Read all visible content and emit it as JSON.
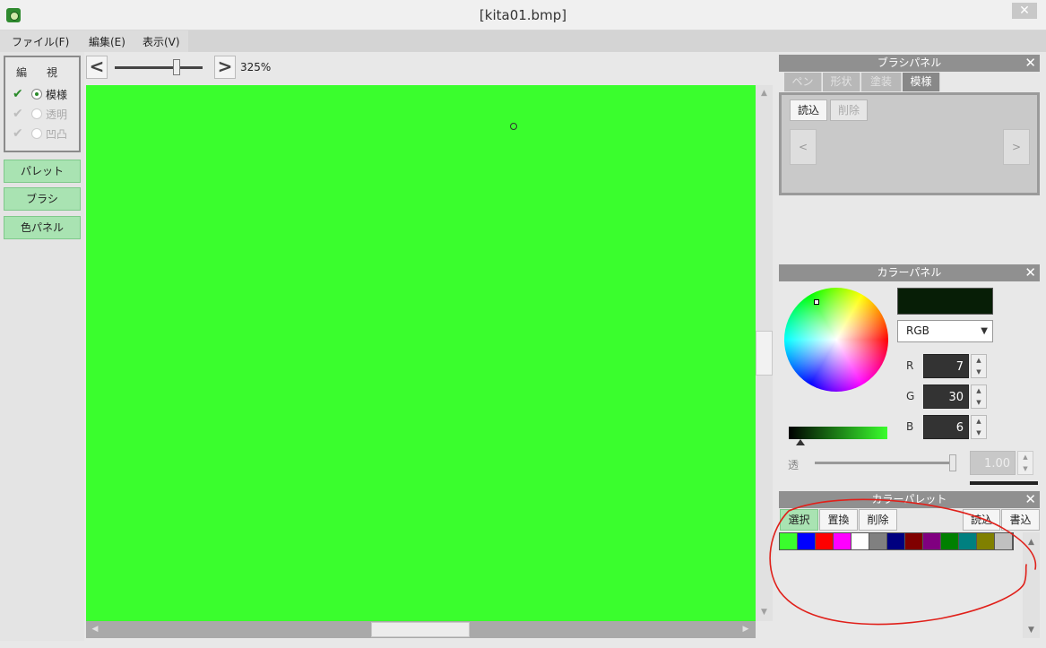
{
  "window": {
    "title": "[kita01.bmp]",
    "close_glyph": "✕"
  },
  "menubar": {
    "items": [
      "ファイル(F)",
      "編集(E)",
      "表示(V)"
    ]
  },
  "view_options": {
    "col_edit": "編",
    "col_view": "視",
    "layers": [
      {
        "label": "模様",
        "checked": true,
        "selected": true,
        "enabled": true
      },
      {
        "label": "透明",
        "checked": true,
        "selected": false,
        "enabled": false
      },
      {
        "label": "凹凸",
        "checked": true,
        "selected": false,
        "enabled": false
      }
    ]
  },
  "left_buttons": [
    "パレット",
    "ブラシ",
    "色パネル"
  ],
  "zoom": {
    "prev_glyph": "<",
    "next_glyph": ">",
    "label": "325%",
    "level": 0.72
  },
  "canvas": {
    "fill_color": "#3afe2d"
  },
  "brush_panel": {
    "title": "ブラシパネル",
    "tabs": [
      {
        "label": "ペン",
        "active": false
      },
      {
        "label": "形状",
        "active": false
      },
      {
        "label": "塗装",
        "active": false
      },
      {
        "label": "模様",
        "active": true
      }
    ],
    "load_label": "読込",
    "delete_label": "削除",
    "prev_glyph": "<",
    "next_glyph": ">"
  },
  "color_panel": {
    "title": "カラーパネル",
    "current_color": "#071e06",
    "mode": "RGB",
    "channels": [
      {
        "label": "R",
        "value": "7"
      },
      {
        "label": "G",
        "value": "30"
      },
      {
        "label": "B",
        "value": "6"
      }
    ],
    "alpha_label": "透",
    "alpha_value": "1.00",
    "alpha_level": 1.0
  },
  "color_palette": {
    "title": "カラーパレット",
    "buttons": {
      "select": "選択",
      "replace": "置換",
      "delete": "削除",
      "load": "読込",
      "save": "書込"
    },
    "colors": [
      "#3afe2d",
      "#0000ff",
      "#ff0000",
      "#ff00ff",
      "#ffffff",
      "#808080",
      "#000080",
      "#800000",
      "#800080",
      "#008000",
      "#008080",
      "#808000",
      "#c0c0c0"
    ]
  },
  "icons": {
    "spin_up": "▲",
    "spin_down": "▼",
    "scroll_up": "▲",
    "scroll_down": "▼",
    "scroll_left": "◀",
    "scroll_right": "▶",
    "checkmark": "✔",
    "dropdown": "▼"
  },
  "annotation_color": "#e0201a"
}
